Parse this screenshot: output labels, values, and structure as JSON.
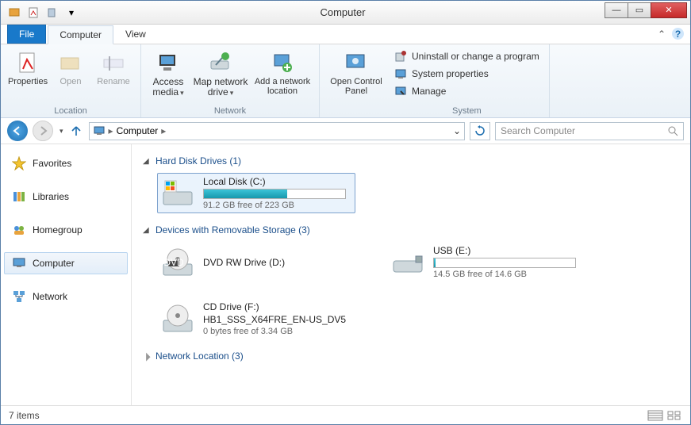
{
  "window": {
    "title": "Computer"
  },
  "tabs": {
    "file": "File",
    "computer": "Computer",
    "view": "View"
  },
  "ribbon": {
    "location": {
      "label": "Location",
      "properties": "Properties",
      "open": "Open",
      "rename": "Rename"
    },
    "network": {
      "label": "Network",
      "access_media": "Access media",
      "map_drive": "Map network drive",
      "add_location": "Add a network location"
    },
    "system": {
      "label": "System",
      "open_control_panel": "Open Control Panel",
      "uninstall": "Uninstall or change a program",
      "system_props": "System properties",
      "manage": "Manage"
    }
  },
  "address": {
    "root": "Computer",
    "search_placeholder": "Search Computer"
  },
  "sidebar": {
    "favorites": "Favorites",
    "libraries": "Libraries",
    "homegroup": "Homegroup",
    "computer": "Computer",
    "network": "Network"
  },
  "content": {
    "hdd_header": "Hard Disk Drives (1)",
    "removable_header": "Devices with Removable Storage (3)",
    "netloc_header": "Network Location (3)",
    "drives": {
      "c": {
        "name": "Local Disk (C:)",
        "free": "91.2 GB free of 223 GB",
        "fill_pct": 59
      },
      "d": {
        "name": "DVD RW Drive (D:)"
      },
      "e_top": {
        "top": "USB (E:)",
        "free": "14.5 GB free of 14.6 GB",
        "fill_pct": 1
      },
      "f": {
        "name": "CD Drive (F:)",
        "sub": "HB1_SSS_X64FRE_EN-US_DV5",
        "free": "0 bytes free of 3.34 GB"
      }
    }
  },
  "status": {
    "items": "7 items"
  }
}
